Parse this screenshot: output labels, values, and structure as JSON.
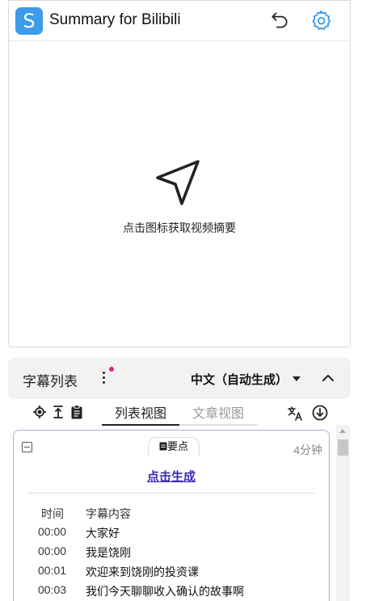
{
  "header": {
    "logo_letter": "S",
    "title": "Summary for Bilibili",
    "brand_color": "#3d9be9",
    "icons": [
      "undo-icon",
      "gear-icon"
    ]
  },
  "summary": {
    "icon": "send-icon",
    "hint": "点击图标获取视频摘要"
  },
  "subtitle_bar": {
    "title": "字幕列表",
    "language": "中文（自动生成）",
    "icons": [
      "more-vert-icon",
      "caret-down-icon",
      "chevron-up-icon"
    ],
    "notification_dot_color": "#e0248c"
  },
  "toolbar": {
    "icons": [
      "locate-icon",
      "scroll-to-top-icon",
      "clipboard-icon",
      "translate-icon",
      "download-icon"
    ],
    "tabs": [
      {
        "label": "列表视图",
        "active": true
      },
      {
        "label": "文章视图",
        "active": false
      }
    ]
  },
  "content": {
    "section_tab": "要点",
    "duration": "4分钟",
    "generate_label": "点击生成",
    "columns": {
      "time": "时间",
      "text": "字幕内容"
    },
    "rows": [
      {
        "time": "00:00",
        "text": "大家好"
      },
      {
        "time": "00:00",
        "text": "我是饶刚"
      },
      {
        "time": "00:01",
        "text": "欢迎来到饶刚的投资课"
      },
      {
        "time": "00:03",
        "text": "我们今天聊聊收入确认的故事啊"
      }
    ]
  }
}
